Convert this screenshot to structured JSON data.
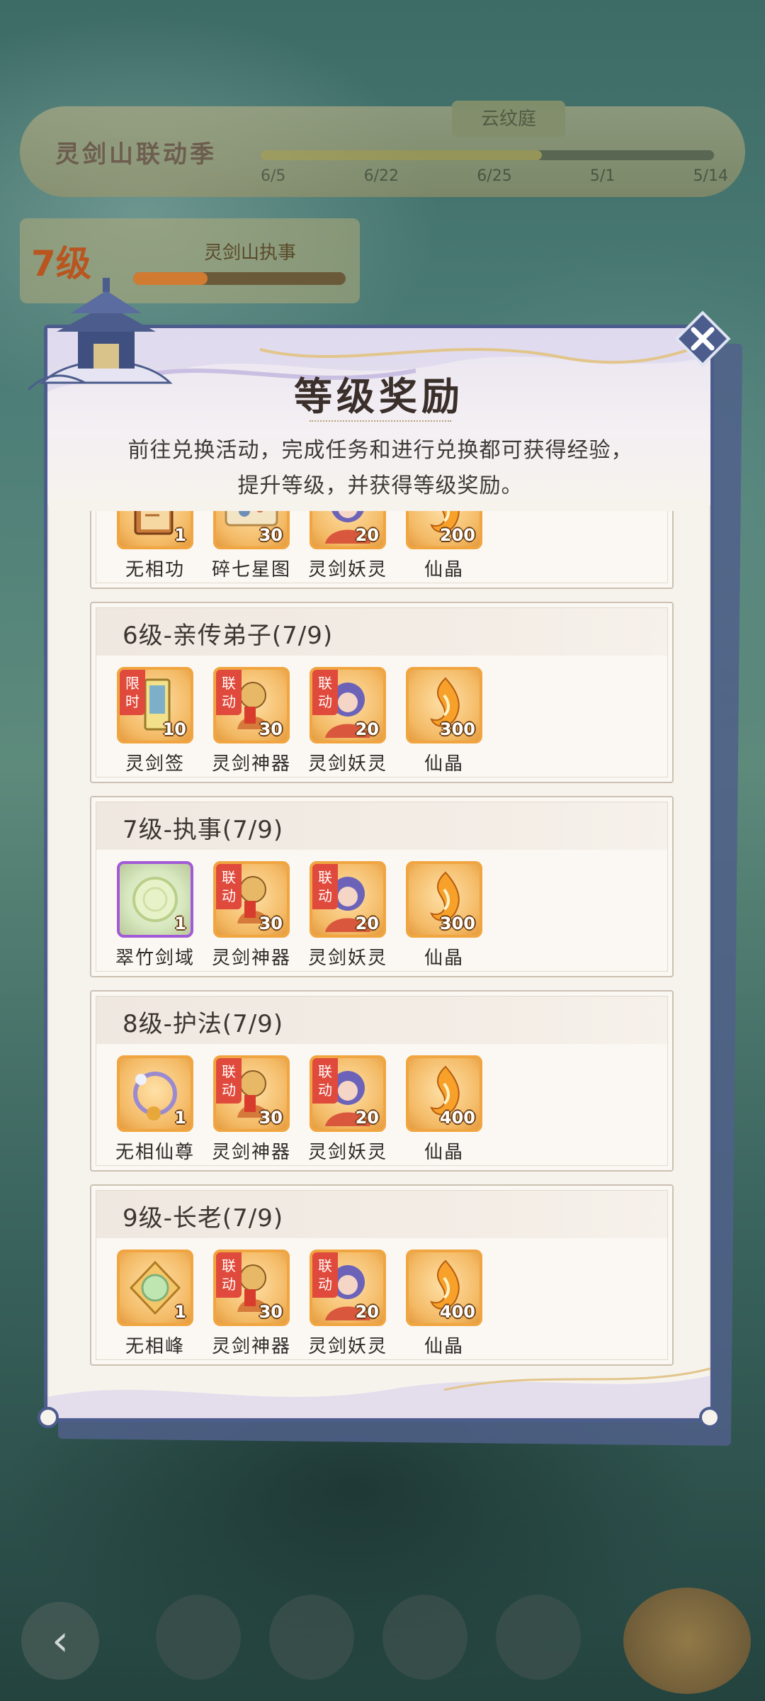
{
  "background": {
    "event_title": "灵剑山联动季",
    "event_tag": "云纹庭",
    "progress_ticks": [
      "6/5",
      "6/22",
      "6/25",
      "5/1",
      "5/14"
    ],
    "level_label": "7级",
    "level_caption": "灵剑山执事"
  },
  "modal": {
    "title": "等级奖励",
    "description_line1": "前往兑换活动，完成任务和进行兑换都可获得经验，",
    "description_line2": "提升等级，并获得等级奖励。",
    "close_icon": "close-icon"
  },
  "rows": [
    {
      "title": "",
      "items": [
        {
          "name": "无相功",
          "qty": "1",
          "icon": "book-icon",
          "tag": ""
        },
        {
          "name": "碎七星图",
          "qty": "30",
          "icon": "scroll-map-icon",
          "tag": ""
        },
        {
          "name": "灵剑妖灵",
          "qty": "20",
          "icon": "spirit-portrait-icon",
          "tag": ""
        },
        {
          "name": "仙晶",
          "qty": "200",
          "icon": "flame-crystal-icon",
          "tag": ""
        }
      ]
    },
    {
      "title": "6级-亲传弟子(7/9)",
      "items": [
        {
          "name": "灵剑签",
          "qty": "10",
          "icon": "talisman-icon",
          "tag": "限时"
        },
        {
          "name": "灵剑神器",
          "qty": "30",
          "icon": "divine-beast-icon",
          "tag": "联动"
        },
        {
          "name": "灵剑妖灵",
          "qty": "20",
          "icon": "spirit-portrait-icon",
          "tag": "联动"
        },
        {
          "name": "仙晶",
          "qty": "300",
          "icon": "flame-crystal-icon",
          "tag": ""
        }
      ]
    },
    {
      "title": "7级-执事(7/9)",
      "items": [
        {
          "name": "翠竹剑域",
          "qty": "1",
          "icon": "jade-orb-icon",
          "tag": ""
        },
        {
          "name": "灵剑神器",
          "qty": "30",
          "icon": "divine-beast-icon",
          "tag": "联动"
        },
        {
          "name": "灵剑妖灵",
          "qty": "20",
          "icon": "spirit-portrait-icon",
          "tag": "联动"
        },
        {
          "name": "仙晶",
          "qty": "300",
          "icon": "flame-crystal-icon",
          "tag": ""
        }
      ]
    },
    {
      "title": "8级-护法(7/9)",
      "items": [
        {
          "name": "无相仙尊",
          "qty": "1",
          "icon": "flower-wreath-icon",
          "tag": ""
        },
        {
          "name": "灵剑神器",
          "qty": "30",
          "icon": "divine-beast-icon",
          "tag": "联动"
        },
        {
          "name": "灵剑妖灵",
          "qty": "20",
          "icon": "spirit-portrait-icon",
          "tag": "联动"
        },
        {
          "name": "仙晶",
          "qty": "400",
          "icon": "flame-crystal-icon",
          "tag": ""
        }
      ]
    },
    {
      "title": "9级-长老(7/9)",
      "items": [
        {
          "name": "无相峰",
          "qty": "1",
          "icon": "jade-peak-icon",
          "tag": ""
        },
        {
          "name": "灵剑神器",
          "qty": "30",
          "icon": "divine-beast-icon",
          "tag": "联动"
        },
        {
          "name": "灵剑妖灵",
          "qty": "20",
          "icon": "spirit-portrait-icon",
          "tag": "联动"
        },
        {
          "name": "仙晶",
          "qty": "400",
          "icon": "flame-crystal-icon",
          "tag": ""
        }
      ]
    }
  ],
  "colors": {
    "frame": "#4c5d8d",
    "item_border": "#f0a540",
    "rare_border": "#a25ad6",
    "tag_red": "#e04a3c"
  }
}
